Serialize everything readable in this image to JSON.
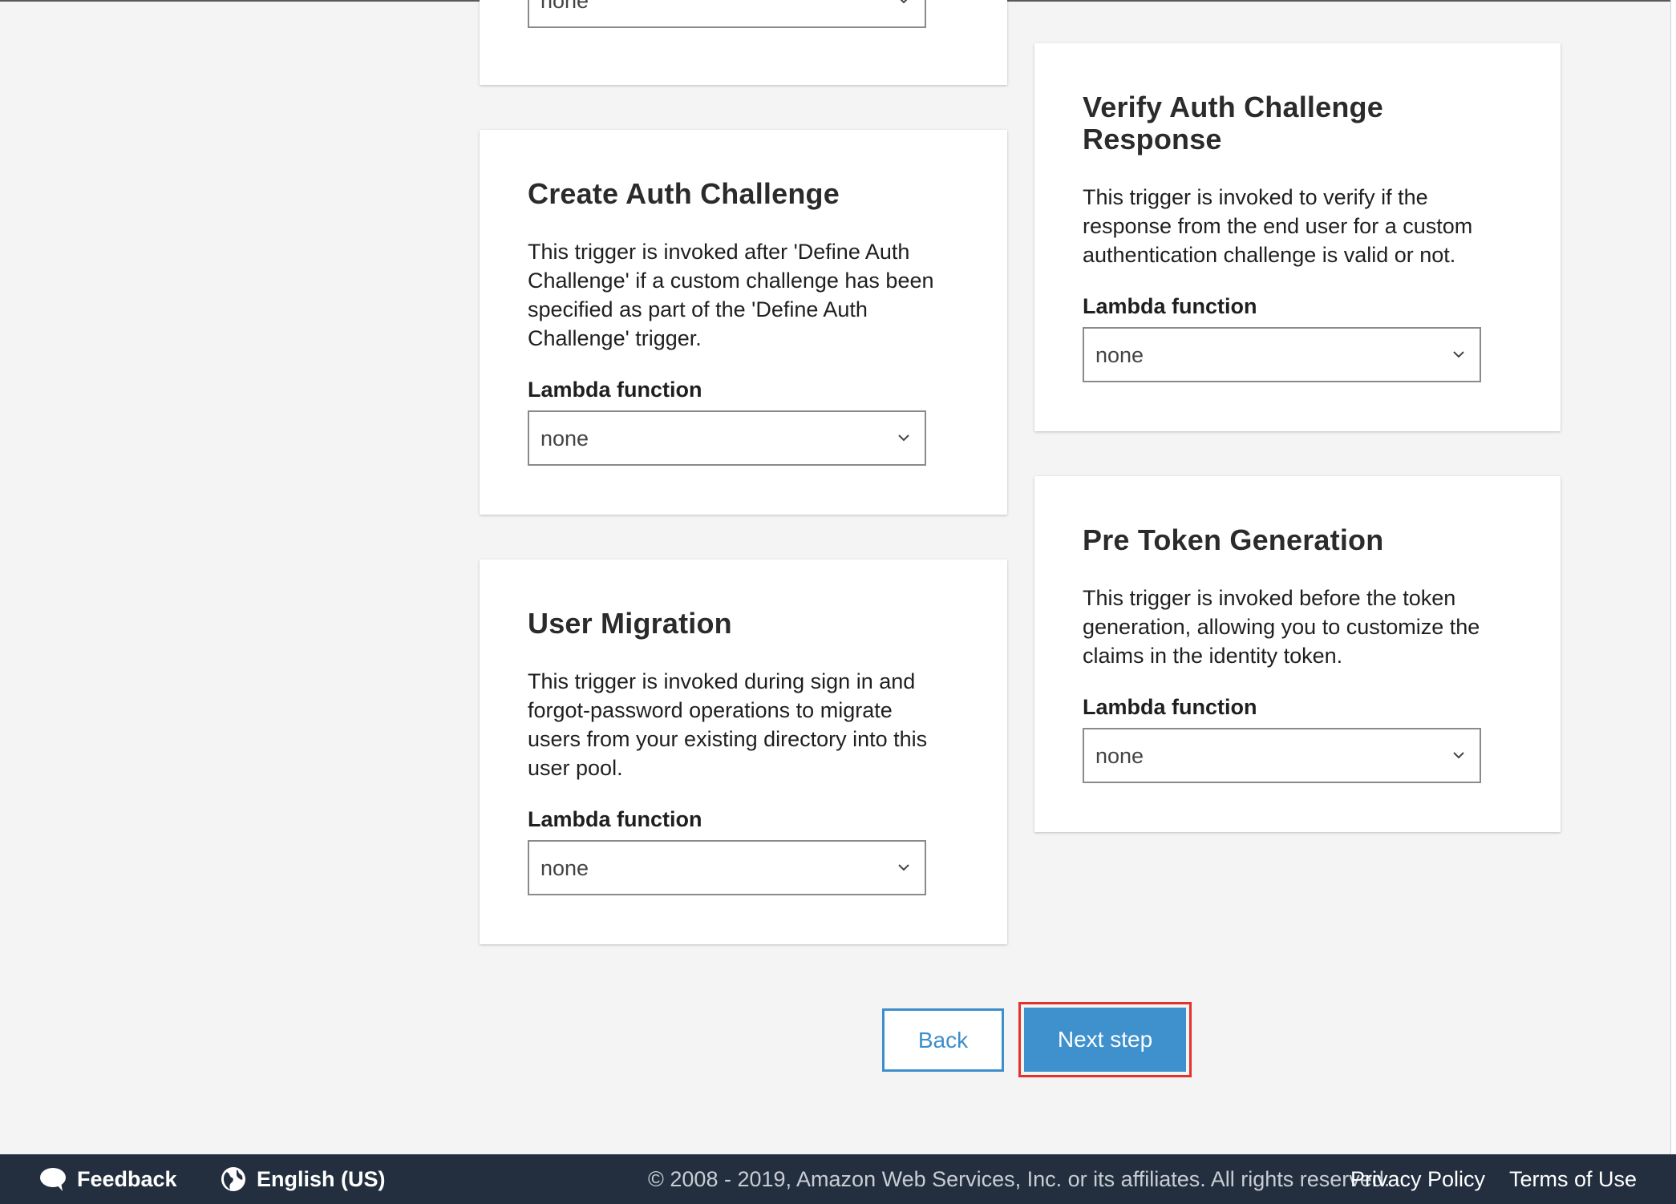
{
  "cards": {
    "top_partial": {
      "select_value": "none"
    },
    "create_auth_challenge": {
      "title": "Create Auth Challenge",
      "desc_lines": [
        "This trigger is invoked after 'Define Auth",
        "Challenge' if a custom challenge has been",
        "specified as part of the 'Define Auth",
        "Challenge' trigger."
      ],
      "field_label": "Lambda function",
      "select_value": "none"
    },
    "user_migration": {
      "title": "User Migration",
      "desc_lines": [
        "This trigger is invoked during sign in and",
        "forgot-password operations to migrate",
        "users from your existing directory into this",
        "user pool."
      ],
      "field_label": "Lambda function",
      "select_value": "none"
    },
    "verify_auth_challenge": {
      "title_lines": [
        "Verify Auth Challenge",
        "Response"
      ],
      "desc_lines": [
        "This trigger is invoked to verify if the",
        "response from the end user for a custom",
        "authentication challenge is valid or not."
      ],
      "field_label": "Lambda function",
      "select_value": "none"
    },
    "pre_token_generation": {
      "title": "Pre Token Generation",
      "desc_lines": [
        "This trigger is invoked before the token",
        "generation, allowing you to customize the",
        "claims in the identity token."
      ],
      "field_label": "Lambda function",
      "select_value": "none"
    }
  },
  "actions": {
    "back_label": "Back",
    "next_label": "Next step"
  },
  "footer": {
    "feedback_label": "Feedback",
    "language_label": "English (US)",
    "copyright": "© 2008 - 2019, Amazon Web Services, Inc. or its affiliates. All rights reserved.",
    "privacy_label": "Privacy Policy",
    "terms_label": "Terms of Use"
  },
  "colors": {
    "accent": "#3e91cc",
    "highlight": "#e5312b",
    "footer_bg": "#232f3e"
  },
  "icons": [
    "chevron-down-icon",
    "speech-bubble-icon",
    "globe-icon"
  ]
}
